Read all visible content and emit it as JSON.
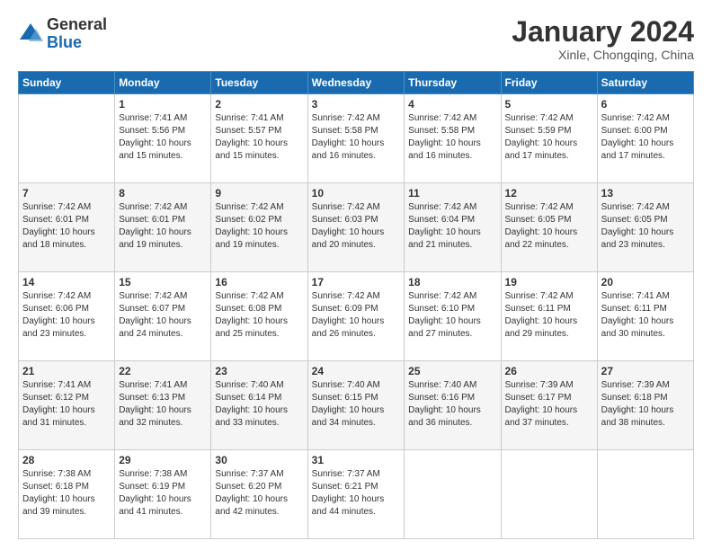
{
  "logo": {
    "general": "General",
    "blue": "Blue"
  },
  "header": {
    "title": "January 2024",
    "location": "Xinle, Chongqing, China"
  },
  "weekdays": [
    "Sunday",
    "Monday",
    "Tuesday",
    "Wednesday",
    "Thursday",
    "Friday",
    "Saturday"
  ],
  "weeks": [
    [
      {
        "day": "",
        "info": ""
      },
      {
        "day": "1",
        "info": "Sunrise: 7:41 AM\nSunset: 5:56 PM\nDaylight: 10 hours\nand 15 minutes."
      },
      {
        "day": "2",
        "info": "Sunrise: 7:41 AM\nSunset: 5:57 PM\nDaylight: 10 hours\nand 15 minutes."
      },
      {
        "day": "3",
        "info": "Sunrise: 7:42 AM\nSunset: 5:58 PM\nDaylight: 10 hours\nand 16 minutes."
      },
      {
        "day": "4",
        "info": "Sunrise: 7:42 AM\nSunset: 5:58 PM\nDaylight: 10 hours\nand 16 minutes."
      },
      {
        "day": "5",
        "info": "Sunrise: 7:42 AM\nSunset: 5:59 PM\nDaylight: 10 hours\nand 17 minutes."
      },
      {
        "day": "6",
        "info": "Sunrise: 7:42 AM\nSunset: 6:00 PM\nDaylight: 10 hours\nand 17 minutes."
      }
    ],
    [
      {
        "day": "7",
        "info": "Sunrise: 7:42 AM\nSunset: 6:01 PM\nDaylight: 10 hours\nand 18 minutes."
      },
      {
        "day": "8",
        "info": "Sunrise: 7:42 AM\nSunset: 6:01 PM\nDaylight: 10 hours\nand 19 minutes."
      },
      {
        "day": "9",
        "info": "Sunrise: 7:42 AM\nSunset: 6:02 PM\nDaylight: 10 hours\nand 19 minutes."
      },
      {
        "day": "10",
        "info": "Sunrise: 7:42 AM\nSunset: 6:03 PM\nDaylight: 10 hours\nand 20 minutes."
      },
      {
        "day": "11",
        "info": "Sunrise: 7:42 AM\nSunset: 6:04 PM\nDaylight: 10 hours\nand 21 minutes."
      },
      {
        "day": "12",
        "info": "Sunrise: 7:42 AM\nSunset: 6:05 PM\nDaylight: 10 hours\nand 22 minutes."
      },
      {
        "day": "13",
        "info": "Sunrise: 7:42 AM\nSunset: 6:05 PM\nDaylight: 10 hours\nand 23 minutes."
      }
    ],
    [
      {
        "day": "14",
        "info": "Sunrise: 7:42 AM\nSunset: 6:06 PM\nDaylight: 10 hours\nand 23 minutes."
      },
      {
        "day": "15",
        "info": "Sunrise: 7:42 AM\nSunset: 6:07 PM\nDaylight: 10 hours\nand 24 minutes."
      },
      {
        "day": "16",
        "info": "Sunrise: 7:42 AM\nSunset: 6:08 PM\nDaylight: 10 hours\nand 25 minutes."
      },
      {
        "day": "17",
        "info": "Sunrise: 7:42 AM\nSunset: 6:09 PM\nDaylight: 10 hours\nand 26 minutes."
      },
      {
        "day": "18",
        "info": "Sunrise: 7:42 AM\nSunset: 6:10 PM\nDaylight: 10 hours\nand 27 minutes."
      },
      {
        "day": "19",
        "info": "Sunrise: 7:42 AM\nSunset: 6:11 PM\nDaylight: 10 hours\nand 29 minutes."
      },
      {
        "day": "20",
        "info": "Sunrise: 7:41 AM\nSunset: 6:11 PM\nDaylight: 10 hours\nand 30 minutes."
      }
    ],
    [
      {
        "day": "21",
        "info": "Sunrise: 7:41 AM\nSunset: 6:12 PM\nDaylight: 10 hours\nand 31 minutes."
      },
      {
        "day": "22",
        "info": "Sunrise: 7:41 AM\nSunset: 6:13 PM\nDaylight: 10 hours\nand 32 minutes."
      },
      {
        "day": "23",
        "info": "Sunrise: 7:40 AM\nSunset: 6:14 PM\nDaylight: 10 hours\nand 33 minutes."
      },
      {
        "day": "24",
        "info": "Sunrise: 7:40 AM\nSunset: 6:15 PM\nDaylight: 10 hours\nand 34 minutes."
      },
      {
        "day": "25",
        "info": "Sunrise: 7:40 AM\nSunset: 6:16 PM\nDaylight: 10 hours\nand 36 minutes."
      },
      {
        "day": "26",
        "info": "Sunrise: 7:39 AM\nSunset: 6:17 PM\nDaylight: 10 hours\nand 37 minutes."
      },
      {
        "day": "27",
        "info": "Sunrise: 7:39 AM\nSunset: 6:18 PM\nDaylight: 10 hours\nand 38 minutes."
      }
    ],
    [
      {
        "day": "28",
        "info": "Sunrise: 7:38 AM\nSunset: 6:18 PM\nDaylight: 10 hours\nand 39 minutes."
      },
      {
        "day": "29",
        "info": "Sunrise: 7:38 AM\nSunset: 6:19 PM\nDaylight: 10 hours\nand 41 minutes."
      },
      {
        "day": "30",
        "info": "Sunrise: 7:37 AM\nSunset: 6:20 PM\nDaylight: 10 hours\nand 42 minutes."
      },
      {
        "day": "31",
        "info": "Sunrise: 7:37 AM\nSunset: 6:21 PM\nDaylight: 10 hours\nand 44 minutes."
      },
      {
        "day": "",
        "info": ""
      },
      {
        "day": "",
        "info": ""
      },
      {
        "day": "",
        "info": ""
      }
    ]
  ]
}
